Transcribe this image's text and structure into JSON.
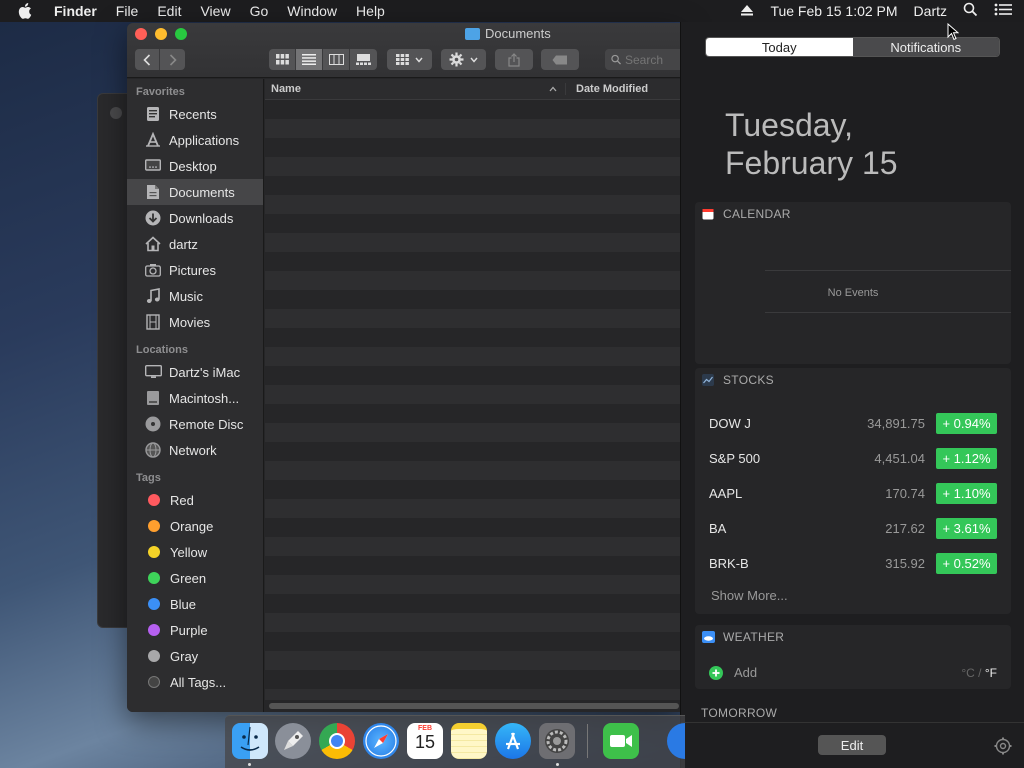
{
  "menubar": {
    "items": [
      "Finder",
      "File",
      "Edit",
      "View",
      "Go",
      "Window",
      "Help"
    ],
    "datetime": "Tue Feb 15  1:02 PM",
    "user": "Dartz"
  },
  "finder": {
    "title": "Documents",
    "search_placeholder": "Search",
    "columns": {
      "name": "Name",
      "date": "Date Modified"
    },
    "sidebar": {
      "favorites_label": "Favorites",
      "favorites": [
        "Recents",
        "Applications",
        "Desktop",
        "Documents",
        "Downloads",
        "dartz",
        "Pictures",
        "Music",
        "Movies"
      ],
      "locations_label": "Locations",
      "locations": [
        "Dartz's iMac",
        "Macintosh...",
        "Remote Disc",
        "Network"
      ],
      "tags_label": "Tags",
      "tags": [
        {
          "label": "Red",
          "color": "#ff5a5f"
        },
        {
          "label": "Orange",
          "color": "#ff9f2e"
        },
        {
          "label": "Yellow",
          "color": "#f5d328"
        },
        {
          "label": "Green",
          "color": "#3ed35a"
        },
        {
          "label": "Blue",
          "color": "#3b8ff6"
        },
        {
          "label": "Purple",
          "color": "#b660f0"
        },
        {
          "label": "Gray",
          "color": "#a8a8aa"
        }
      ],
      "all_tags": "All Tags..."
    }
  },
  "nc": {
    "tab_today": "Today",
    "tab_notifications": "Notifications",
    "date_line1": "Tuesday,",
    "date_line2": "February 15",
    "calendar": {
      "title": "CALENDAR",
      "empty": "No Events"
    },
    "stocks": {
      "title": "STOCKS",
      "rows": [
        {
          "symbol": "DOW J",
          "price": "34,891.75",
          "change": "+ 0.94%"
        },
        {
          "symbol": "S&P 500",
          "price": "4,451.04",
          "change": "+ 1.12%"
        },
        {
          "symbol": "AAPL",
          "price": "170.74",
          "change": "+ 1.10%"
        },
        {
          "symbol": "BA",
          "price": "217.62",
          "change": "+ 3.61%"
        },
        {
          "symbol": "BRK-B",
          "price": "315.92",
          "change": "+ 0.52%"
        }
      ],
      "show_more": "Show More..."
    },
    "weather": {
      "title": "WEATHER",
      "add": "Add",
      "unit_c": "°C",
      "unit_sep": "/",
      "unit_f": "°F"
    },
    "tomorrow": "TOMORROW",
    "edit": "Edit"
  },
  "dock": {
    "calendar_month": "FEB",
    "calendar_day": "15"
  }
}
